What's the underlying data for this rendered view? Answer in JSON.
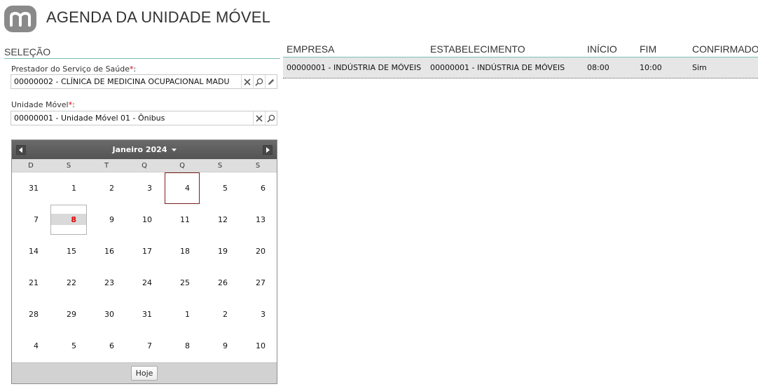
{
  "header": {
    "title": "AGENDA DA UNIDADE MÓVEL",
    "logo_icon": "m-logo-icon"
  },
  "selection": {
    "title": "SELEÇÃO",
    "provider": {
      "label": "Prestador do Serviço de Saúde",
      "required_mark": "*",
      "colon": ":",
      "value": "00000002 - CLÍNICA DE MEDICINA OCUPACIONAL MADU"
    },
    "mobile_unit": {
      "label": "Unidade Móvel",
      "required_mark": "*",
      "colon": ":",
      "value": "00000001 - Unidade Móvel 01 - Ônibus"
    }
  },
  "calendar": {
    "month_label": "Janeiro 2024",
    "weekdays": [
      "D",
      "S",
      "T",
      "Q",
      "Q",
      "S",
      "S"
    ],
    "days": [
      [
        "31",
        "1",
        "2",
        "3",
        "4",
        "5",
        "6"
      ],
      [
        "7",
        "8",
        "9",
        "10",
        "11",
        "12",
        "13"
      ],
      [
        "14",
        "15",
        "16",
        "17",
        "18",
        "19",
        "20"
      ],
      [
        "21",
        "22",
        "23",
        "24",
        "25",
        "26",
        "27"
      ],
      [
        "28",
        "29",
        "30",
        "31",
        "1",
        "2",
        "3"
      ],
      [
        "4",
        "5",
        "6",
        "7",
        "8",
        "9",
        "10"
      ]
    ],
    "selected_day": "4",
    "today_day": "8",
    "today_button": "Hoje",
    "colors": {
      "today": "#e00000",
      "selected_border": "#7a1e1e"
    }
  },
  "schedule": {
    "columns": [
      "EMPRESA",
      "ESTABELECIMENTO",
      "INÍCIO",
      "FIM",
      "CONFIRMADO"
    ],
    "rows": [
      {
        "empresa": "00000001 - INDÚSTRIA DE MÓVEIS",
        "estabelecimento": "00000001 - INDÚSTRIA DE MÓVEIS",
        "inicio": "08:00",
        "fim": "10:00",
        "confirmado": "Sim"
      }
    ]
  },
  "colors": {
    "accent_line": "#7fbfb8",
    "required": "#dd0000"
  }
}
